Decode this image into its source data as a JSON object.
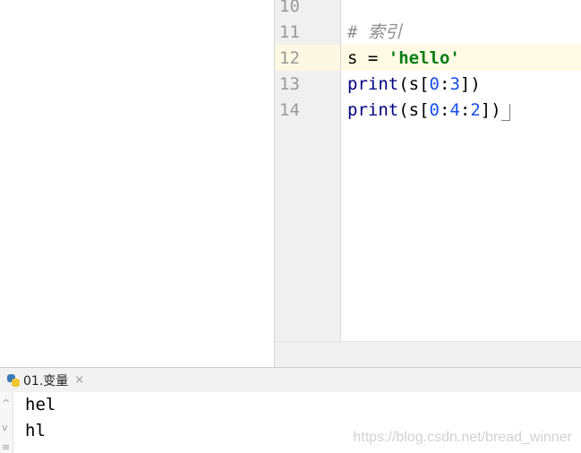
{
  "editor": {
    "line_numbers": [
      "10",
      "11",
      "12",
      "13",
      "14"
    ],
    "lines": [
      {
        "tokens": []
      },
      {
        "tokens": [
          {
            "t": "# 索引",
            "c": "comment"
          }
        ]
      },
      {
        "tokens": [
          {
            "t": "s = ",
            "c": ""
          },
          {
            "t": "'hello'",
            "c": "str"
          }
        ]
      },
      {
        "tokens": [
          {
            "t": "print",
            "c": "fn"
          },
          {
            "t": "(s[",
            "c": ""
          },
          {
            "t": "0",
            "c": "num"
          },
          {
            "t": ":",
            "c": ""
          },
          {
            "t": "3",
            "c": "num"
          },
          {
            "t": "])",
            "c": ""
          }
        ]
      },
      {
        "tokens": [
          {
            "t": "print",
            "c": "fn"
          },
          {
            "t": "(s[",
            "c": ""
          },
          {
            "t": "0",
            "c": "num"
          },
          {
            "t": ":",
            "c": ""
          },
          {
            "t": "4",
            "c": "num"
          },
          {
            "t": ":",
            "c": ""
          },
          {
            "t": "2",
            "c": "num"
          },
          {
            "t": "])",
            "c": ""
          }
        ]
      }
    ],
    "current_line_number": "12"
  },
  "run_panel": {
    "tab_label": "01.变量",
    "icons": {
      "tab": "python-icon",
      "close": "close-icon"
    },
    "close_glyph": "×",
    "output_lines": [
      "hel",
      "hl"
    ]
  },
  "watermark": "https://blog.csdn.net/bread_winner",
  "colors": {
    "comment": "#8c8c8c",
    "string": "#067d17",
    "number": "#1750eb",
    "function": "#000080",
    "current_line": "#fffae3"
  }
}
